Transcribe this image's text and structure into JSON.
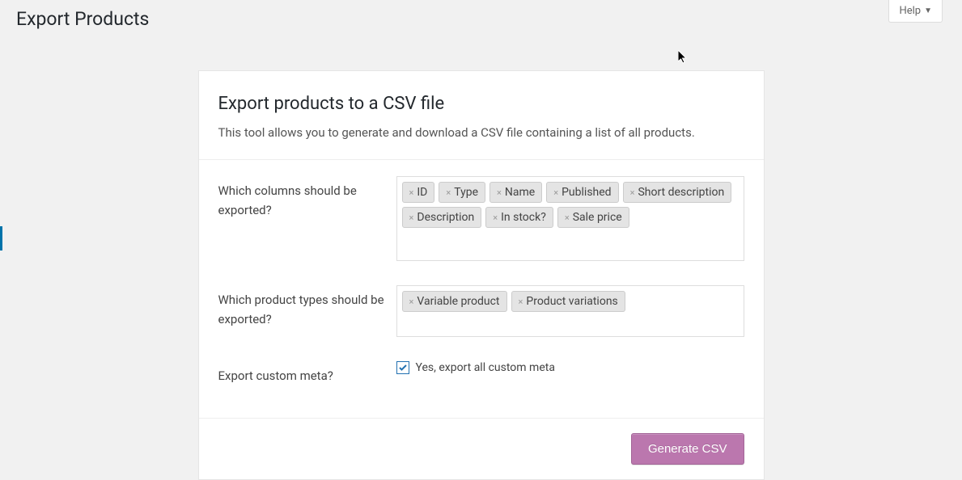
{
  "header": {
    "title": "Export Products",
    "help_label": "Help"
  },
  "panel": {
    "title": "Export products to a CSV file",
    "description": "This tool allows you to generate and download a CSV file containing a list of all products."
  },
  "form": {
    "columns": {
      "label": "Which columns should be exported?",
      "tags": [
        "ID",
        "Type",
        "Name",
        "Published",
        "Short description",
        "Description",
        "In stock?",
        "Sale price"
      ]
    },
    "product_types": {
      "label": "Which product types should be exported?",
      "tags": [
        "Variable product",
        "Product variations"
      ]
    },
    "custom_meta": {
      "label": "Export custom meta?",
      "checkbox_label": "Yes, export all custom meta",
      "checked": true
    }
  },
  "footer": {
    "generate_label": "Generate CSV"
  }
}
